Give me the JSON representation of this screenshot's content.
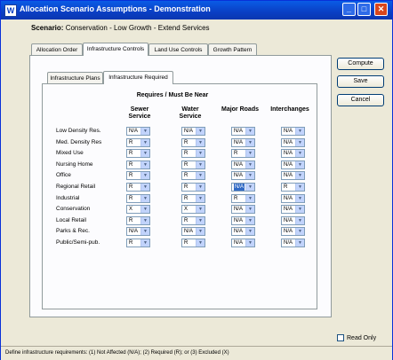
{
  "window": {
    "title": "Allocation Scenario Assumptions - Demonstration",
    "icon": "W"
  },
  "scenario": {
    "label": "Scenario:",
    "value": "Conservation - Low Growth - Extend Services"
  },
  "outer_tabs": [
    "Allocation Order",
    "Infrastructure Controls",
    "Land Use Controls",
    "Growth Pattern"
  ],
  "inner_tabs": [
    "Infrastructure Plans",
    "Infrastructure Required"
  ],
  "section_header": "Requires / Must Be Near",
  "columns": [
    "Sewer Service",
    "Water Service",
    "Major Roads",
    "Interchanges"
  ],
  "rows": [
    {
      "label": "Low Density Res.",
      "values": [
        "N/A",
        "N/A",
        "N/A",
        "N/A"
      ]
    },
    {
      "label": "Med. Density Res",
      "values": [
        "R",
        "R",
        "N/A",
        "N/A"
      ]
    },
    {
      "label": "Mixed Use",
      "values": [
        "R",
        "R",
        "R",
        "N/A"
      ]
    },
    {
      "label": "Nursing Home",
      "values": [
        "R",
        "R",
        "N/A",
        "N/A"
      ]
    },
    {
      "label": "Office",
      "values": [
        "R",
        "R",
        "N/A",
        "N/A"
      ]
    },
    {
      "label": "Regional Retail",
      "values": [
        "R",
        "R",
        "N/A",
        "R"
      ]
    },
    {
      "label": "Industrial",
      "values": [
        "R",
        "R",
        "R",
        "N/A"
      ]
    },
    {
      "label": "Conservation",
      "values": [
        "X",
        "X",
        "N/A",
        "N/A"
      ]
    },
    {
      "label": "Local Retail",
      "values": [
        "R",
        "R",
        "N/A",
        "N/A"
      ]
    },
    {
      "label": "Parks & Rec.",
      "values": [
        "N/A",
        "N/A",
        "N/A",
        "N/A"
      ]
    },
    {
      "label": "Public/Semi-pub.",
      "values": [
        "R",
        "R",
        "N/A",
        "N/A"
      ]
    }
  ],
  "buttons": {
    "compute": "Compute",
    "save": "Save",
    "cancel": "Cancel"
  },
  "readonly_label": "Read Only",
  "status": "Define infrastructure requirements: (1) Not Affected (N/A); (2) Required (R); or (3) Excluded (X)",
  "icons": {
    "dropdown": "chevron-down-icon",
    "minimize": "minimize-icon",
    "maximize": "maximize-icon",
    "close": "close-icon"
  }
}
